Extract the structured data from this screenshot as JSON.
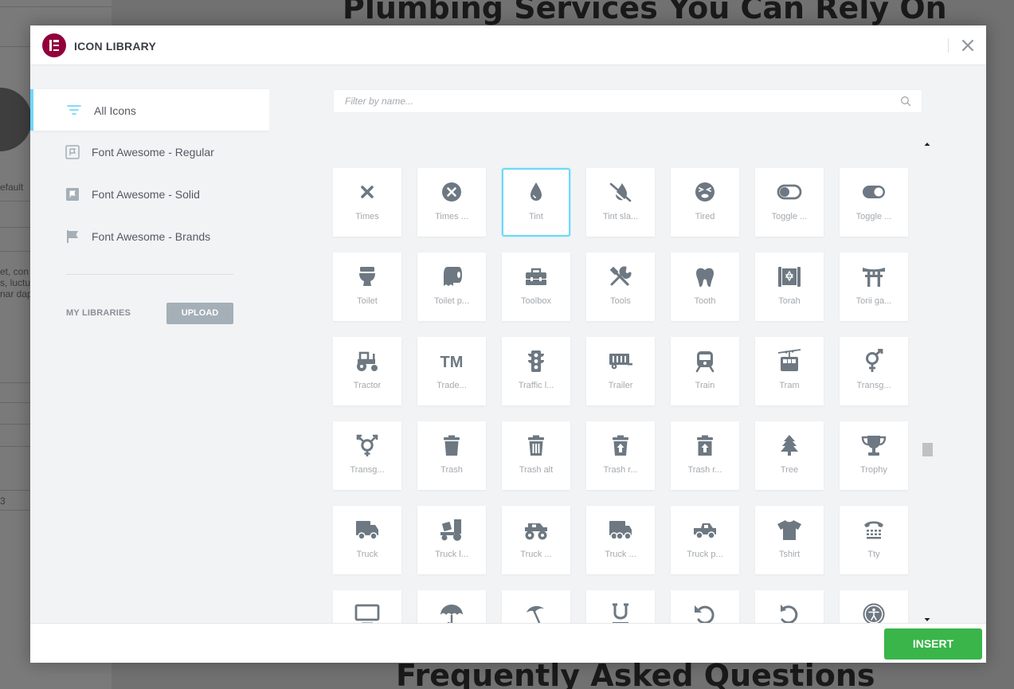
{
  "background": {
    "heading_top": "Plumbing Services You Can Rely On",
    "heading_bottom": "Frequently Asked Questions",
    "left_fragments": [
      "efault",
      "et, con",
      "s, luctu",
      "nar dap",
      "3"
    ]
  },
  "modal": {
    "title": "ICON LIBRARY",
    "close_icon": "close-icon"
  },
  "sidebar": {
    "items": [
      {
        "label": "All Icons",
        "icon": "filter-lines-icon",
        "active": true
      },
      {
        "label": "Font Awesome - Regular",
        "icon": "flag-outline-icon",
        "active": false
      },
      {
        "label": "Font Awesome - Solid",
        "icon": "flag-solid-icon",
        "active": false
      },
      {
        "label": "Font Awesome - Brands",
        "icon": "flag-brand-icon",
        "active": false
      }
    ],
    "my_libraries_label": "MY LIBRARIES",
    "upload_label": "UPLOAD"
  },
  "search": {
    "placeholder": "Filter by name...",
    "value": ""
  },
  "icons": [
    {
      "name": "Times",
      "icon": "times-icon"
    },
    {
      "name": "Times ...",
      "icon": "times-circle-icon"
    },
    {
      "name": "Tint",
      "icon": "tint-icon",
      "selected": true
    },
    {
      "name": "Tint sla...",
      "icon": "tint-slash-icon"
    },
    {
      "name": "Tired",
      "icon": "tired-icon"
    },
    {
      "name": "Toggle ...",
      "icon": "toggle-off-icon"
    },
    {
      "name": "Toggle ...",
      "icon": "toggle-on-icon"
    },
    {
      "name": "Toilet",
      "icon": "toilet-icon"
    },
    {
      "name": "Toilet p...",
      "icon": "toilet-paper-icon"
    },
    {
      "name": "Toolbox",
      "icon": "toolbox-icon"
    },
    {
      "name": "Tools",
      "icon": "tools-icon"
    },
    {
      "name": "Tooth",
      "icon": "tooth-icon"
    },
    {
      "name": "Torah",
      "icon": "torah-icon"
    },
    {
      "name": "Torii ga...",
      "icon": "torii-gate-icon"
    },
    {
      "name": "Tractor",
      "icon": "tractor-icon"
    },
    {
      "name": "Trade...",
      "icon": "trademark-icon"
    },
    {
      "name": "Traffic l...",
      "icon": "traffic-light-icon"
    },
    {
      "name": "Trailer",
      "icon": "trailer-icon"
    },
    {
      "name": "Train",
      "icon": "train-icon"
    },
    {
      "name": "Tram",
      "icon": "tram-icon"
    },
    {
      "name": "Transg...",
      "icon": "transgender-icon"
    },
    {
      "name": "Transg...",
      "icon": "transgender-alt-icon"
    },
    {
      "name": "Trash",
      "icon": "trash-icon"
    },
    {
      "name": "Trash alt",
      "icon": "trash-alt-icon"
    },
    {
      "name": "Trash r...",
      "icon": "trash-restore-icon"
    },
    {
      "name": "Trash r...",
      "icon": "trash-restore-alt-icon"
    },
    {
      "name": "Tree",
      "icon": "tree-icon"
    },
    {
      "name": "Trophy",
      "icon": "trophy-icon"
    },
    {
      "name": "Truck",
      "icon": "truck-icon"
    },
    {
      "name": "Truck l...",
      "icon": "truck-loading-icon"
    },
    {
      "name": "Truck ...",
      "icon": "truck-monster-icon"
    },
    {
      "name": "Truck ...",
      "icon": "truck-moving-icon"
    },
    {
      "name": "Truck p...",
      "icon": "truck-pickup-icon"
    },
    {
      "name": "Tshirt",
      "icon": "tshirt-icon"
    },
    {
      "name": "Tty",
      "icon": "tty-icon"
    },
    {
      "name": "",
      "icon": "tv-icon"
    },
    {
      "name": "",
      "icon": "umbrella-icon"
    },
    {
      "name": "",
      "icon": "umbrella-beach-icon"
    },
    {
      "name": "",
      "icon": "underline-icon"
    },
    {
      "name": "",
      "icon": "undo-icon"
    },
    {
      "name": "",
      "icon": "undo-alt-icon"
    },
    {
      "name": "",
      "icon": "universal-access-icon"
    }
  ],
  "footer": {
    "insert_label": "INSERT"
  },
  "colors": {
    "accent": "#71d7f7",
    "brand": "#92003b",
    "insert": "#39b54a",
    "icon": "#6d7882"
  }
}
